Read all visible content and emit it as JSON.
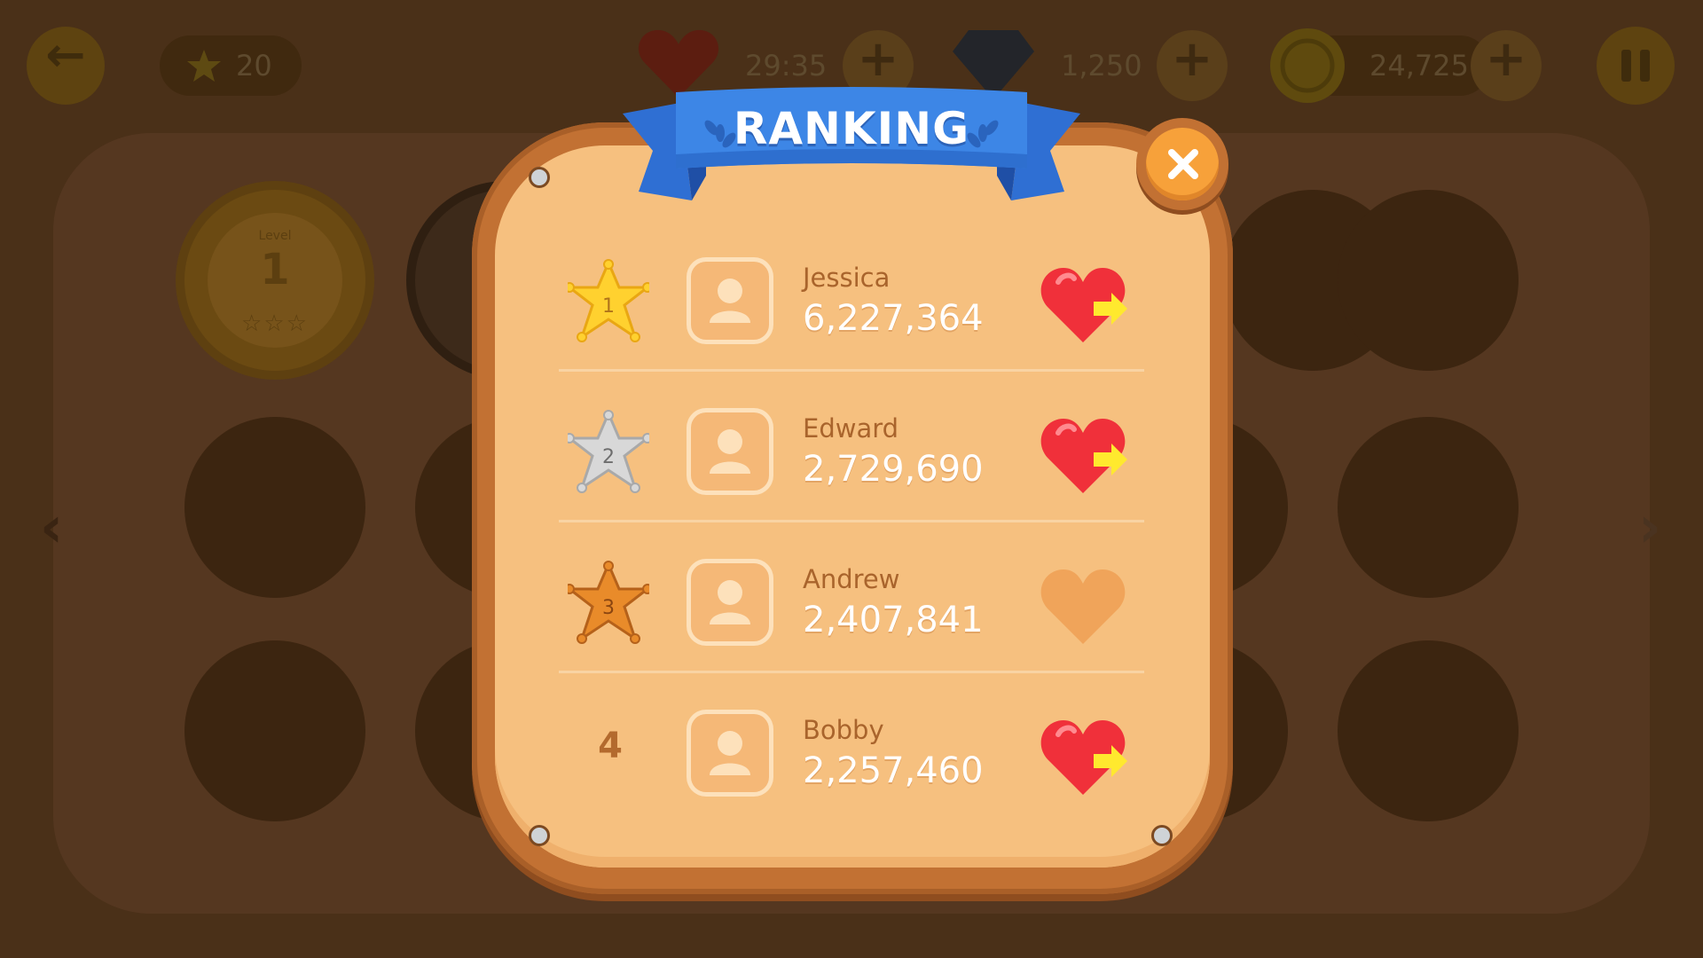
{
  "hud": {
    "stars": "20",
    "lives_timer": "29:35",
    "gems": "1,250",
    "coins": "24,725"
  },
  "background_level": {
    "caption": "Level",
    "number": "1",
    "stars": "☆☆☆"
  },
  "dialog": {
    "title": "RANKING",
    "close_icon": "close-icon"
  },
  "ranking": [
    {
      "rank": "1",
      "badge": "gold-sheriff-star",
      "name": "Jessica",
      "score": "6,227,364",
      "send_life": true
    },
    {
      "rank": "2",
      "badge": "silver-sheriff-star",
      "name": "Edward",
      "score": "2,729,690",
      "send_life": true
    },
    {
      "rank": "3",
      "badge": "bronze-sheriff-star",
      "name": "Andrew",
      "score": "2,407,841",
      "send_life": false
    },
    {
      "rank": "4",
      "badge": "none",
      "name": "Bobby",
      "score": "2,257,460",
      "send_life": true
    }
  ],
  "colors": {
    "gold": "#ffd12f",
    "silver": "#d8d8d8",
    "bronze": "#e98b2a",
    "heart_active": "#f0303a",
    "heart_inactive": "#f0a45a",
    "ribbon": "#3d86e6",
    "close_button": "#f7a13a"
  }
}
